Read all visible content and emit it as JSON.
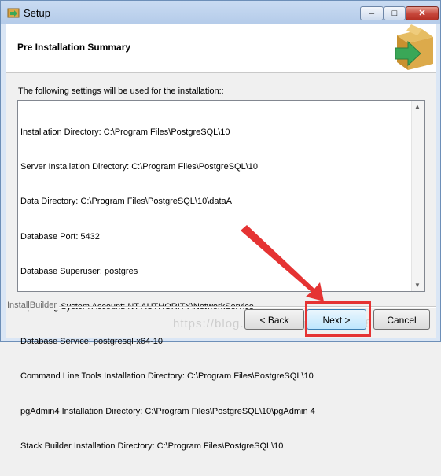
{
  "window": {
    "title": "Setup",
    "minimize_symbol": "‒",
    "maximize_symbol": "□",
    "close_symbol": "✕"
  },
  "header": {
    "title": "Pre Installation Summary",
    "logo_icon": "box-with-green-arrow-icon"
  },
  "subtitle": "The following settings will be used for the installation::",
  "summary_lines": [
    "Installation Directory: C:\\Program Files\\PostgreSQL\\10",
    "Server Installation Directory: C:\\Program Files\\PostgreSQL\\10",
    "Data Directory: C:\\Program Files\\PostgreSQL\\10\\dataA",
    "Database Port: 5432",
    "Database Superuser: postgres",
    "Operating System Account: NT AUTHORITY\\NetworkService",
    "Database Service: postgresql-x64-10",
    "Command Line Tools Installation Directory: C:\\Program Files\\PostgreSQL\\10",
    "pgAdmin4 Installation Directory: C:\\Program Files\\PostgreSQL\\10\\pgAdmin 4",
    "Stack Builder Installation Directory: C:\\Program Files\\PostgreSQL\\10"
  ],
  "footer": {
    "brand": "InstallBuilder"
  },
  "buttons": {
    "back": "< Back",
    "next": "Next >",
    "cancel": "Cancel"
  },
  "annotation": {
    "highlight_color": "#e53333"
  },
  "watermark": "https://blog.csdn.net/qq_39551686"
}
